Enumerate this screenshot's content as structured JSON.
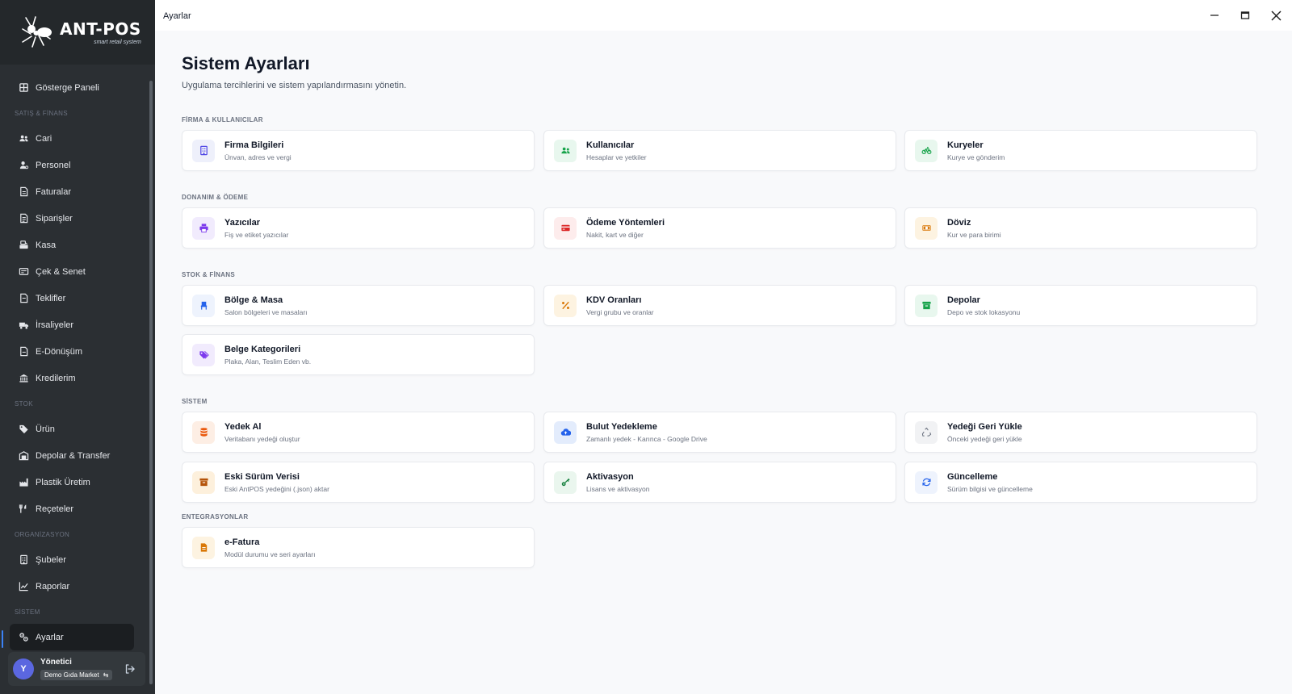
{
  "app": {
    "logo_title": "ANT-POS",
    "logo_subtitle": "smart retail system",
    "window_title": "Ayarlar"
  },
  "sidebar": {
    "items": [
      {
        "type": "item",
        "label": "Gösterge Paneli",
        "icon": "dashboard-icon"
      },
      {
        "type": "section",
        "label": "SATIŞ & FİNANS"
      },
      {
        "type": "item",
        "label": "Cari",
        "icon": "users-icon"
      },
      {
        "type": "item",
        "label": "Personel",
        "icon": "person-icon"
      },
      {
        "type": "item",
        "label": "Faturalar",
        "icon": "invoice-icon"
      },
      {
        "type": "item",
        "label": "Siparişler",
        "icon": "order-icon"
      },
      {
        "type": "item",
        "label": "Kasa",
        "icon": "cash-register-icon"
      },
      {
        "type": "item",
        "label": "Çek & Senet",
        "icon": "cheque-icon"
      },
      {
        "type": "item",
        "label": "Teklifler",
        "icon": "offer-icon"
      },
      {
        "type": "item",
        "label": "İrsaliyeler",
        "icon": "truck-icon"
      },
      {
        "type": "item",
        "label": "E-Dönüşüm",
        "icon": "document-icon"
      },
      {
        "type": "item",
        "label": "Kredilerim",
        "icon": "bank-icon"
      },
      {
        "type": "section",
        "label": "STOK"
      },
      {
        "type": "item",
        "label": "Ürün",
        "icon": "tag-icon"
      },
      {
        "type": "item",
        "label": "Depolar & Transfer",
        "icon": "warehouse-icon"
      },
      {
        "type": "item",
        "label": "Plastik Üretim",
        "icon": "factory-icon"
      },
      {
        "type": "item",
        "label": "Reçeteler",
        "icon": "utensils-icon"
      },
      {
        "type": "section",
        "label": "ORGANİZASYON"
      },
      {
        "type": "item",
        "label": "Şubeler",
        "icon": "building-icon"
      },
      {
        "type": "item",
        "label": "Raporlar",
        "icon": "chart-line-icon"
      },
      {
        "type": "section",
        "label": "SİSTEM"
      },
      {
        "type": "item",
        "label": "Ayarlar",
        "icon": "settings-icon",
        "active": true
      }
    ],
    "user": {
      "avatar_letter": "Y",
      "name": "Yönetici",
      "store": "Demo Gıda Market"
    }
  },
  "page": {
    "title": "Sistem Ayarları",
    "subtitle": "Uygulama tercihlerini ve sistem yapılandırmasını yönetin."
  },
  "sections": [
    {
      "label": "FİRMA & KULLANICILAR"
    },
    {
      "label": "DONANIM & ÖDEME"
    },
    {
      "label": "STOK & FİNANS"
    },
    {
      "label": "SİSTEM"
    },
    {
      "label": "ENTEGRASYONLAR"
    }
  ],
  "cards": [
    {
      "title": "Firma Bilgileri",
      "subtitle": "Ünvan, adres ve vergi",
      "icon": "building-icon",
      "color": "#4f46e5",
      "bg": "#eef0fb"
    },
    {
      "title": "Kullanıcılar",
      "subtitle": "Hesaplar ve yetkiler",
      "icon": "users-icon",
      "color": "#16a34a",
      "bg": "#e8f7ee"
    },
    {
      "title": "Kuryeler",
      "subtitle": "Kurye ve gönderim",
      "icon": "bicycle-icon",
      "color": "#16a34a",
      "bg": "#e8f7ee"
    },
    {
      "title": "Yazıcılar",
      "subtitle": "Fiş ve etiket yazıcılar",
      "icon": "printer-icon",
      "color": "#7c3aed",
      "bg": "#f1ebfd"
    },
    {
      "title": "Ödeme Yöntemleri",
      "subtitle": "Nakit, kart ve diğer",
      "icon": "credit-card-icon",
      "color": "#dc2626",
      "bg": "#fdecec"
    },
    {
      "title": "Döviz",
      "subtitle": "Kur ve para birimi",
      "icon": "money-bill-icon",
      "color": "#d97706",
      "bg": "#fdf3e1"
    },
    {
      "title": "Bölge & Masa",
      "subtitle": "Salon bölgeleri ve masaları",
      "icon": "chair-icon",
      "color": "#2563eb",
      "bg": "#eef3fd"
    },
    {
      "title": "KDV Oranları",
      "subtitle": "Vergi grubu ve oranlar",
      "icon": "percent-icon",
      "color": "#d97706",
      "bg": "#fdf3e1"
    },
    {
      "title": "Depolar",
      "subtitle": "Depo ve stok lokasyonu",
      "icon": "archive-icon",
      "color": "#16a34a",
      "bg": "#e8f7ee"
    },
    {
      "title": "Belge Kategorileri",
      "subtitle": "Plaka, Alan, Teslim Eden vb.",
      "icon": "tags-icon",
      "color": "#7c3aed",
      "bg": "#f1ebfd"
    },
    {
      "title": "Yedek Al",
      "subtitle": "Veritabanı yedeği oluştur",
      "icon": "database-icon",
      "color": "#ea580c",
      "bg": "#fdeee4"
    },
    {
      "title": "Bulut Yedekleme",
      "subtitle": "Zamanlı yedek - Karınca - Google Drive",
      "icon": "cloud-upload-icon",
      "color": "#2563eb",
      "bg": "#e3ecfc"
    },
    {
      "title": "Yedeği Geri Yükle",
      "subtitle": "Önceki yedeği geri yükle",
      "icon": "recycle-icon",
      "color": "#6b7280",
      "bg": "#f1f2f4"
    },
    {
      "title": "Eski Sürüm Verisi",
      "subtitle": "Eski AntPOS yedeğini (.json) aktar",
      "icon": "box-archive-icon",
      "color": "#b45309",
      "bg": "#fdf0dc"
    },
    {
      "title": "Aktivasyon",
      "subtitle": "Lisans ve aktivasyon",
      "icon": "key-icon",
      "color": "#15803d",
      "bg": "#eaf6ee"
    },
    {
      "title": "Güncelleme",
      "subtitle": "Sürüm bilgisi ve güncelleme",
      "icon": "refresh-icon",
      "color": "#2563eb",
      "bg": "#eef3fd"
    },
    {
      "title": "e-Fatura",
      "subtitle": "Modül durumu ve seri ayarları",
      "icon": "file-invoice-icon",
      "color": "#d97706",
      "bg": "#fdf3e1"
    }
  ]
}
